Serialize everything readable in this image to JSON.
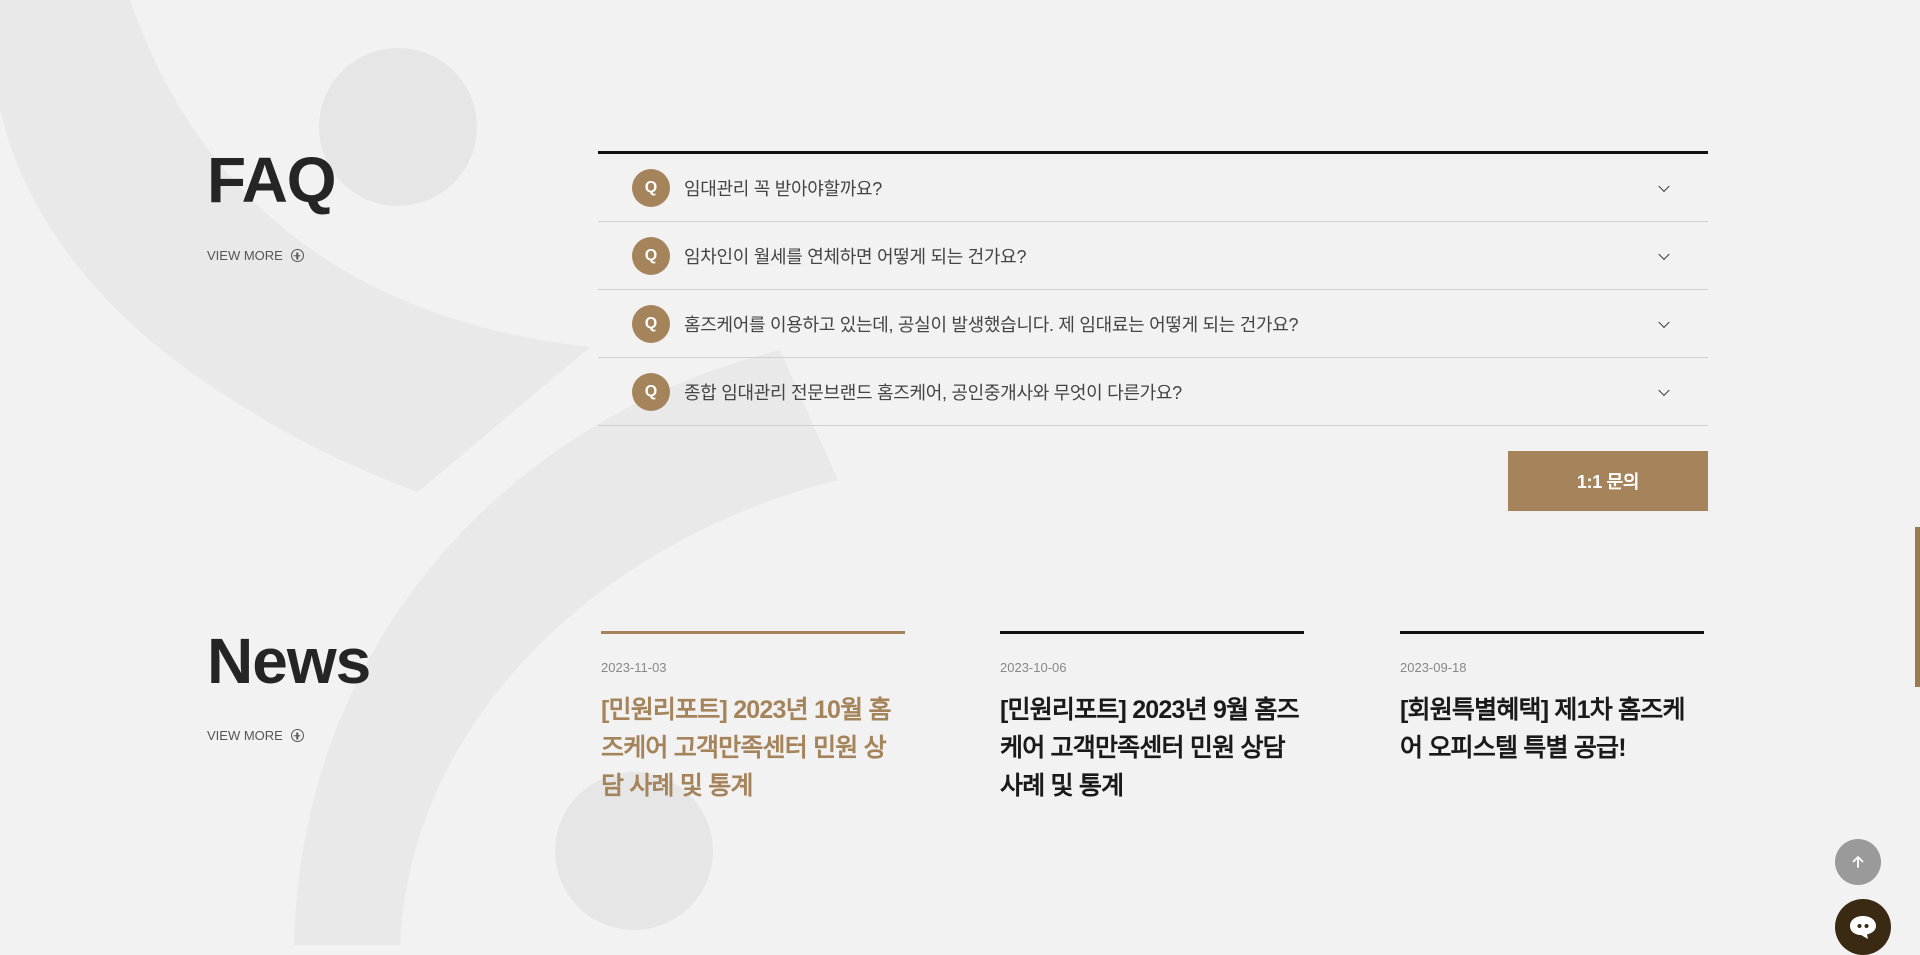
{
  "faq": {
    "title": "FAQ",
    "view_more": "VIEW MORE",
    "items": [
      {
        "badge": "Q",
        "question": "임대관리 꼭 받아야할까요?"
      },
      {
        "badge": "Q",
        "question": "임차인이 월세를 연체하면 어떻게 되는 건가요?"
      },
      {
        "badge": "Q",
        "question": "홈즈케어를 이용하고 있는데, 공실이 발생했습니다. 제 임대료는 어떻게 되는 건가요?"
      },
      {
        "badge": "Q",
        "question": "종합 임대관리 전문브랜드 홈즈케어, 공인중개사와 무엇이 다른가요?"
      }
    ],
    "inquiry_label": "1:1 문의"
  },
  "news": {
    "title": "News",
    "view_more": "VIEW MORE",
    "items": [
      {
        "date": "2023-11-03",
        "title": "[민원리포트] 2023년 10월 홈즈케어 고객만족센터 민원 상담 사례 및 통계",
        "active": true
      },
      {
        "date": "2023-10-06",
        "title": "[민원리포트] 2023년 9월 홈즈케어 고객만족센터 민원 상담 사례 및 통계",
        "active": false
      },
      {
        "date": "2023-09-18",
        "title": "[회원특별혜택] 제1차 홈즈케어 오피스텔 특별 공급!",
        "active": false
      }
    ]
  },
  "floating": {
    "scroll_top_icon": "arrow-up-icon",
    "chat_icon": "chat-bubble-icon"
  },
  "colors": {
    "accent": "#a5845b",
    "background": "#f2f2f2",
    "text_dark": "#222222",
    "chat_button": "#3a2a14"
  }
}
